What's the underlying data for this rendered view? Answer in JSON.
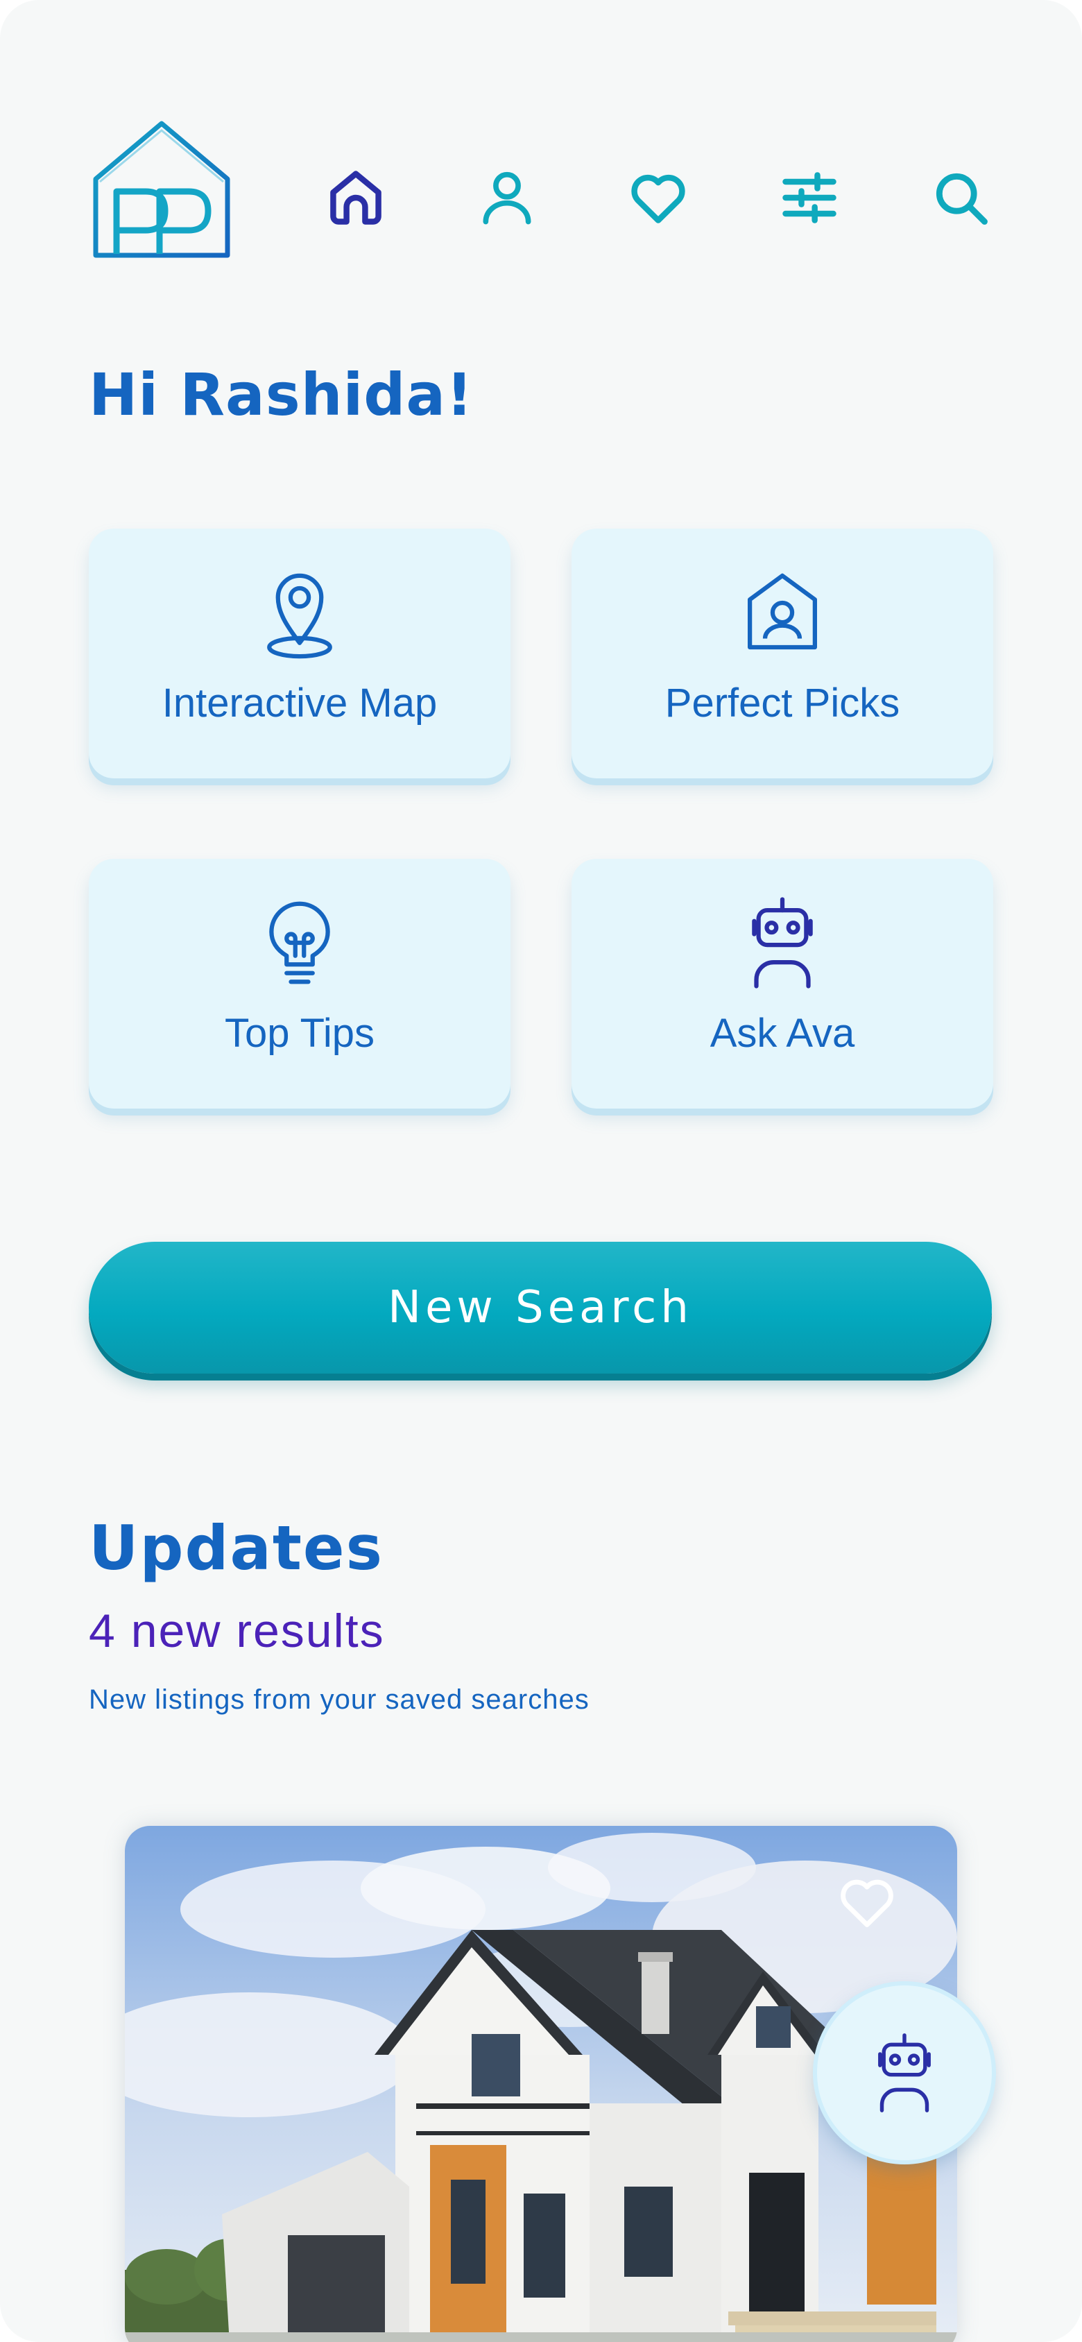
{
  "app": {
    "logo_text": "PP"
  },
  "nav": {
    "items": [
      {
        "name": "home",
        "icon": "home-icon",
        "active": true
      },
      {
        "name": "profile",
        "icon": "user-icon"
      },
      {
        "name": "favorites",
        "icon": "heart-icon"
      },
      {
        "name": "filters",
        "icon": "sliders-icon"
      },
      {
        "name": "search",
        "icon": "search-icon"
      }
    ],
    "active_color": "#2a2fa6",
    "inactive_color": "#0fa9bd"
  },
  "greeting": "Hi Rashida!",
  "features": [
    {
      "label": "Interactive Map",
      "icon": "map-pin-icon"
    },
    {
      "label": "Perfect Picks",
      "icon": "house-user-icon"
    },
    {
      "label": "Top Tips",
      "icon": "lightbulb-icon"
    },
    {
      "label": "Ask Ava",
      "icon": "robot-icon"
    }
  ],
  "new_search_label": "New Search",
  "updates": {
    "title": "Updates",
    "count_text": "4 new results",
    "subtitle": "New listings from your saved searches"
  },
  "listing": {
    "favorited": false,
    "photo": "house-photo"
  },
  "assistant_fab": {
    "icon": "robot-icon"
  },
  "colors": {
    "brand_blue": "#1565c0",
    "accent_teal": "#03a9bf",
    "purple": "#4b22b8",
    "card_bg": "#e4f6fc",
    "page_bg": "#f6f8f8"
  }
}
